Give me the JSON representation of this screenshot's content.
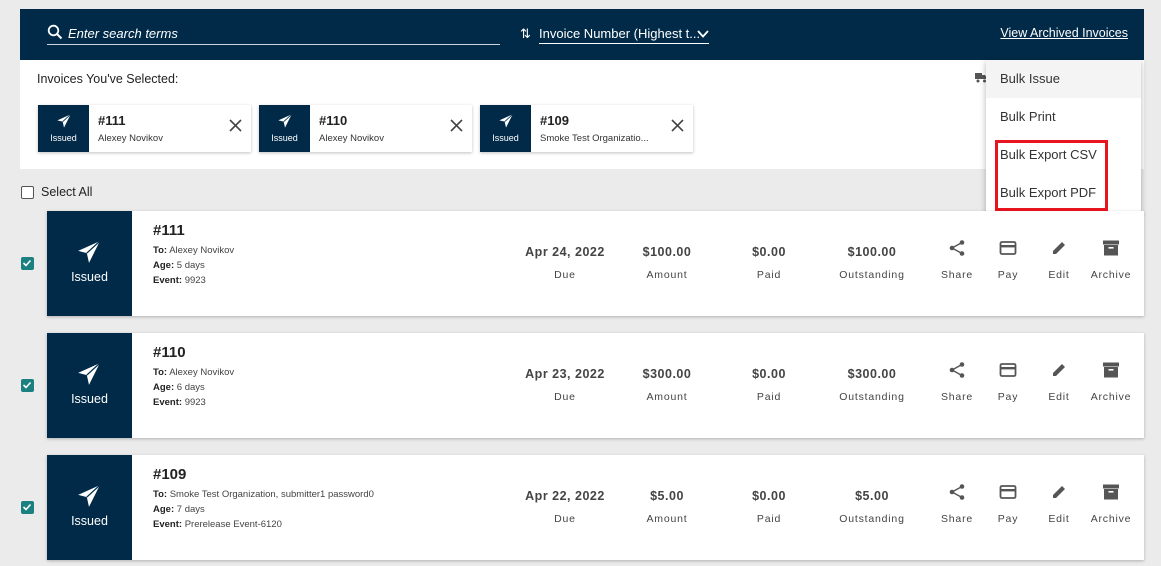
{
  "header": {
    "search_placeholder": "Enter search terms",
    "sort_label": "Invoice Number (Highest t...",
    "archived_link": "View Archived Invoices"
  },
  "selected": {
    "title": "Invoices You've Selected:",
    "chips": [
      {
        "status": "Issued",
        "number": "#111",
        "name": "Alexey Novikov"
      },
      {
        "status": "Issued",
        "number": "#110",
        "name": "Alexey Novikov"
      },
      {
        "status": "Issued",
        "number": "#109",
        "name": "Smoke Test Organizatio..."
      }
    ]
  },
  "menu": {
    "items": [
      "Bulk Issue",
      "Bulk Print",
      "Bulk Export CSV",
      "Bulk Export PDF"
    ]
  },
  "select_all_label": "Select All",
  "invoices": [
    {
      "status": "Issued",
      "number": "#111",
      "to_label": "To:",
      "to": "Alexey Novikov",
      "age_label": "Age:",
      "age": "5 days",
      "event_label": "Event:",
      "event": "9923",
      "due": "Apr 24, 2022",
      "amount": "$100.00",
      "paid": "$0.00",
      "outstanding": "$100.00"
    },
    {
      "status": "Issued",
      "number": "#110",
      "to_label": "To:",
      "to": "Alexey Novikov",
      "age_label": "Age:",
      "age": "6 days",
      "event_label": "Event:",
      "event": "9923",
      "due": "Apr 23, 2022",
      "amount": "$300.00",
      "paid": "$0.00",
      "outstanding": "$300.00"
    },
    {
      "status": "Issued",
      "number": "#109",
      "to_label": "To:",
      "to": "Smoke Test Organization, submitter1 password0",
      "age_label": "Age:",
      "age": "7 days",
      "event_label": "Event:",
      "event": "Prerelease Event-6120",
      "due": "Apr 22, 2022",
      "amount": "$5.00",
      "paid": "$0.00",
      "outstanding": "$5.00"
    }
  ],
  "column_labels": {
    "due": "Due",
    "amount": "Amount",
    "paid": "Paid",
    "outstanding": "Outstanding"
  },
  "action_labels": {
    "share": "Share",
    "pay": "Pay",
    "edit": "Edit",
    "archive": "Archive"
  },
  "icons": {
    "plane": "paper-plane-icon",
    "search": "search-icon",
    "sort": "sort-icon",
    "close": "close-icon",
    "share": "share-icon",
    "pay": "card-icon",
    "edit": "pencil-icon",
    "archive": "archive-box-icon"
  },
  "colors": {
    "navy": "#002a48",
    "checkbox": "#1a8080",
    "highlight": "#e8141f"
  }
}
